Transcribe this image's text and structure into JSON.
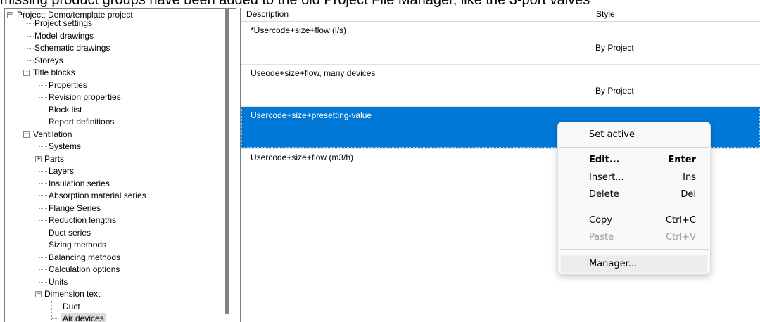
{
  "header_text": "missing product groups have been added to the old Project File Manager, like the 3-port valves",
  "tree": {
    "root_label": "Project: Demo/template project",
    "items": [
      {
        "label": "Project settings"
      },
      {
        "label": "Model drawings"
      },
      {
        "label": "Schematic drawings"
      },
      {
        "label": "Storeys"
      },
      {
        "label": "Title blocks"
      },
      {
        "label": "Properties"
      },
      {
        "label": "Revision properties"
      },
      {
        "label": "Block list"
      },
      {
        "label": "Report definitions"
      },
      {
        "label": "Ventilation"
      },
      {
        "label": "Systems"
      },
      {
        "label": "Parts"
      },
      {
        "label": "Layers"
      },
      {
        "label": "Insulation series"
      },
      {
        "label": "Absorption material series"
      },
      {
        "label": "Flange Series"
      },
      {
        "label": "Reduction lengths"
      },
      {
        "label": "Duct series"
      },
      {
        "label": "Sizing methods"
      },
      {
        "label": "Balancing methods"
      },
      {
        "label": "Calculation options"
      },
      {
        "label": "Units"
      },
      {
        "label": "Dimension text"
      },
      {
        "label": "Duct"
      },
      {
        "label": "Air devices"
      }
    ]
  },
  "table": {
    "headers": {
      "description": "Description",
      "style": "Style"
    },
    "rows": [
      {
        "description": "*Usercode+size+flow (l/s)",
        "style": "By Project"
      },
      {
        "description": "Useode+size+flow, many devices",
        "style": "By Project"
      },
      {
        "description": "Usercode+size+presetting-value",
        "style": ""
      },
      {
        "description": "Usercode+size+flow (m3/h)",
        "style": ""
      }
    ]
  },
  "context_menu": {
    "set_active": "Set active",
    "edit": "Edit...",
    "edit_shortcut": "Enter",
    "insert": "Insert...",
    "insert_shortcut": "Ins",
    "delete": "Delete",
    "delete_shortcut": "Del",
    "copy": "Copy",
    "copy_shortcut": "Ctrl+C",
    "paste": "Paste",
    "paste_shortcut": "Ctrl+V",
    "manager": "Manager..."
  }
}
